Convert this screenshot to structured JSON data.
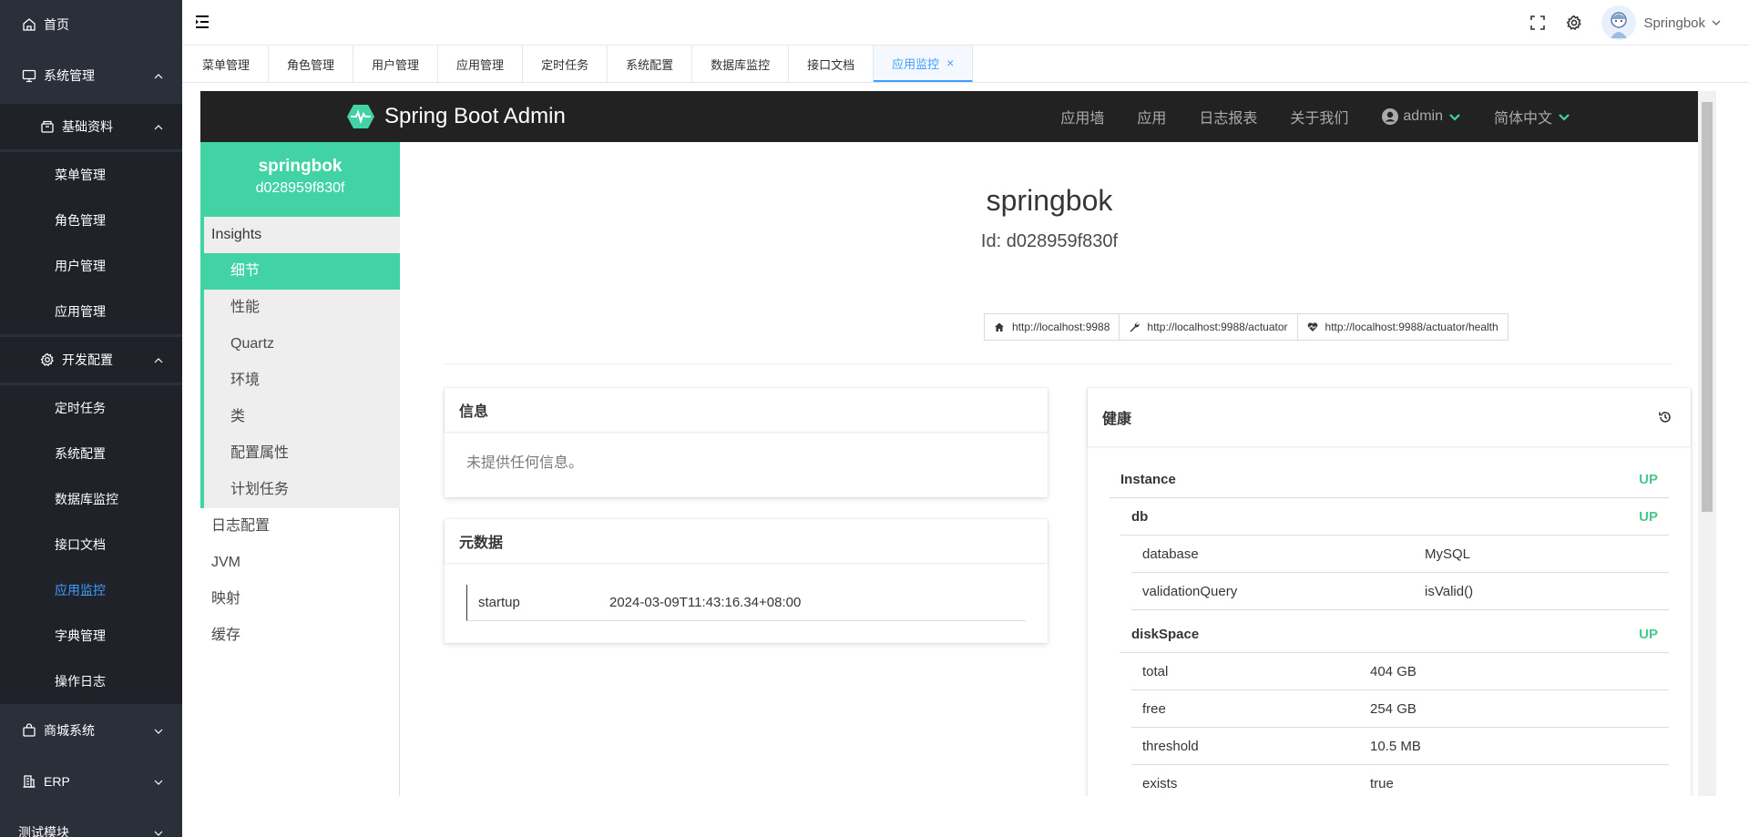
{
  "sidebar": {
    "home": "首页",
    "system": "系统管理",
    "basic": "基础资料",
    "basic_items": [
      "菜单管理",
      "角色管理",
      "用户管理",
      "应用管理"
    ],
    "devconfig": "开发配置",
    "dev_items": [
      "定时任务",
      "系统配置",
      "数据库监控",
      "接口文档",
      "应用监控",
      "字典管理",
      "操作日志"
    ],
    "mall": "商城系统",
    "erp": "ERP",
    "test": "测试模块"
  },
  "header": {
    "username": "Springbok"
  },
  "tags": [
    "菜单管理",
    "角色管理",
    "用户管理",
    "应用管理",
    "定时任务",
    "系统配置",
    "数据库监控",
    "接口文档"
  ],
  "active_tag": "应用监控",
  "sba": {
    "brand": "Spring Boot Admin",
    "menu": [
      "应用墙",
      "应用",
      "日志报表",
      "关于我们"
    ],
    "user": "admin",
    "language": "简体中文",
    "app_name": "springbok",
    "app_id": "d028959f830f",
    "insights_title": "Insights",
    "insights": [
      "细节",
      "性能",
      "Quartz",
      "环境",
      "类",
      "配置属性",
      "计划任务"
    ],
    "side_items": [
      "日志配置",
      "JVM",
      "映射",
      "缓存"
    ],
    "instance_title": "springbok",
    "instance_id": "Id: d028959f830f",
    "links": [
      "http://localhost:9988",
      "http://localhost:9988/actuator",
      "http://localhost:9988/actuator/health"
    ],
    "info_title": "信息",
    "info_empty": "未提供任何信息。",
    "meta_title": "元数据",
    "meta": {
      "key": "startup",
      "value": "2024-03-09T11:43:16.34+08:00"
    },
    "health_title": "健康",
    "health": {
      "instance": "Instance",
      "instance_status": "UP",
      "db": "db",
      "db_status": "UP",
      "db_rows": [
        {
          "k": "database",
          "v": "MySQL"
        },
        {
          "k": "validationQuery",
          "v": "isValid()"
        }
      ],
      "disk": "diskSpace",
      "disk_status": "UP",
      "disk_rows": [
        {
          "k": "total",
          "v": "404 GB"
        },
        {
          "k": "free",
          "v": "254 GB"
        },
        {
          "k": "threshold",
          "v": "10.5 MB"
        },
        {
          "k": "exists",
          "v": "true"
        }
      ]
    }
  },
  "colors": {
    "accent": "#42d3a5",
    "primary": "#409eff",
    "sidebar_bg": "#2b2f3a",
    "nav_bg": "#222222"
  }
}
